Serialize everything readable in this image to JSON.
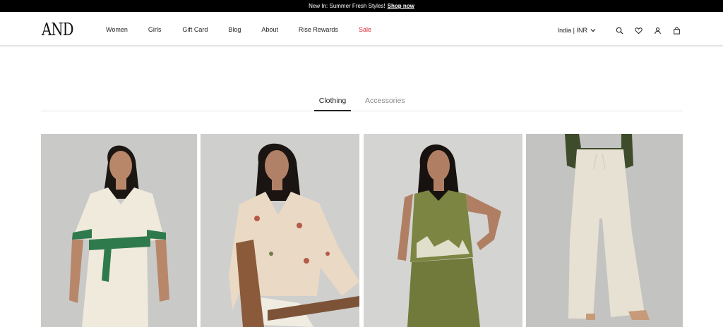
{
  "announcement": {
    "text": "New In: Summer Fresh Styles!",
    "link": "Shop now"
  },
  "header": {
    "logo": "AND",
    "nav": [
      "Women",
      "Girls",
      "Gift Card",
      "Blog",
      "About",
      "Rise Rewards",
      "Sale"
    ],
    "region": "India | INR",
    "icons": [
      "search-icon",
      "heart-icon",
      "user-icon",
      "bag-icon"
    ]
  },
  "tabs": {
    "active": "Clothing",
    "inactive": "Accessories"
  },
  "products": [
    {
      "image": "white-dress-with-green-belt",
      "colors": {
        "background": "#c9c9c7",
        "garment": "#efeadc",
        "accent": "#2f7a4c"
      }
    },
    {
      "image": "floral-jacket",
      "colors": {
        "background": "#cfcfcd",
        "garment": "#ead9c4",
        "accent": "#b65a4a"
      }
    },
    {
      "image": "olive-top-and-skirt",
      "colors": {
        "background": "#d4d4d2",
        "garment": "#7c8541",
        "accent": "#f2efe4"
      }
    },
    {
      "image": "cream-wide-pants",
      "colors": {
        "background": "#c3c3c1",
        "garment": "#e7e1d4",
        "accent": "#3e4c2c"
      }
    }
  ]
}
